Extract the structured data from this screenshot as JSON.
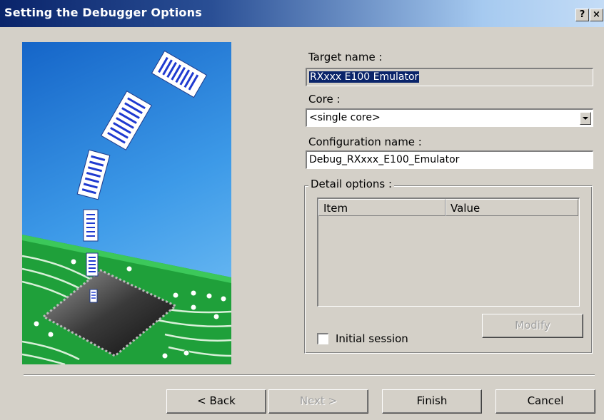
{
  "window": {
    "title": "Setting the Debugger Options",
    "help_button": "?",
    "close_button": "×"
  },
  "form": {
    "target_name_label": "Target name :",
    "target_name_value": "RXxxx E100 Emulator",
    "core_label": "Core :",
    "core_value": "<single core>",
    "config_name_label": "Configuration name :",
    "config_name_value": "Debug_RXxxx_E100_Emulator",
    "detail_options_label": "Detail options :",
    "list_columns": [
      "Item",
      "Value"
    ],
    "modify_button": "Modify",
    "initial_session_label": "Initial session",
    "initial_session_checked": false
  },
  "footer": {
    "back_button": "< Back",
    "next_button": "Next >",
    "finish_button": "Finish",
    "cancel_button": "Cancel"
  },
  "colors": {
    "title_bar_start": "#0a246a",
    "title_bar_end": "#a6caf0",
    "selection": "#0a246a",
    "dialog_face": "#d4d0c8",
    "illustration_sky": "#1f7fd8",
    "circuit_board": "#1fa03a"
  }
}
